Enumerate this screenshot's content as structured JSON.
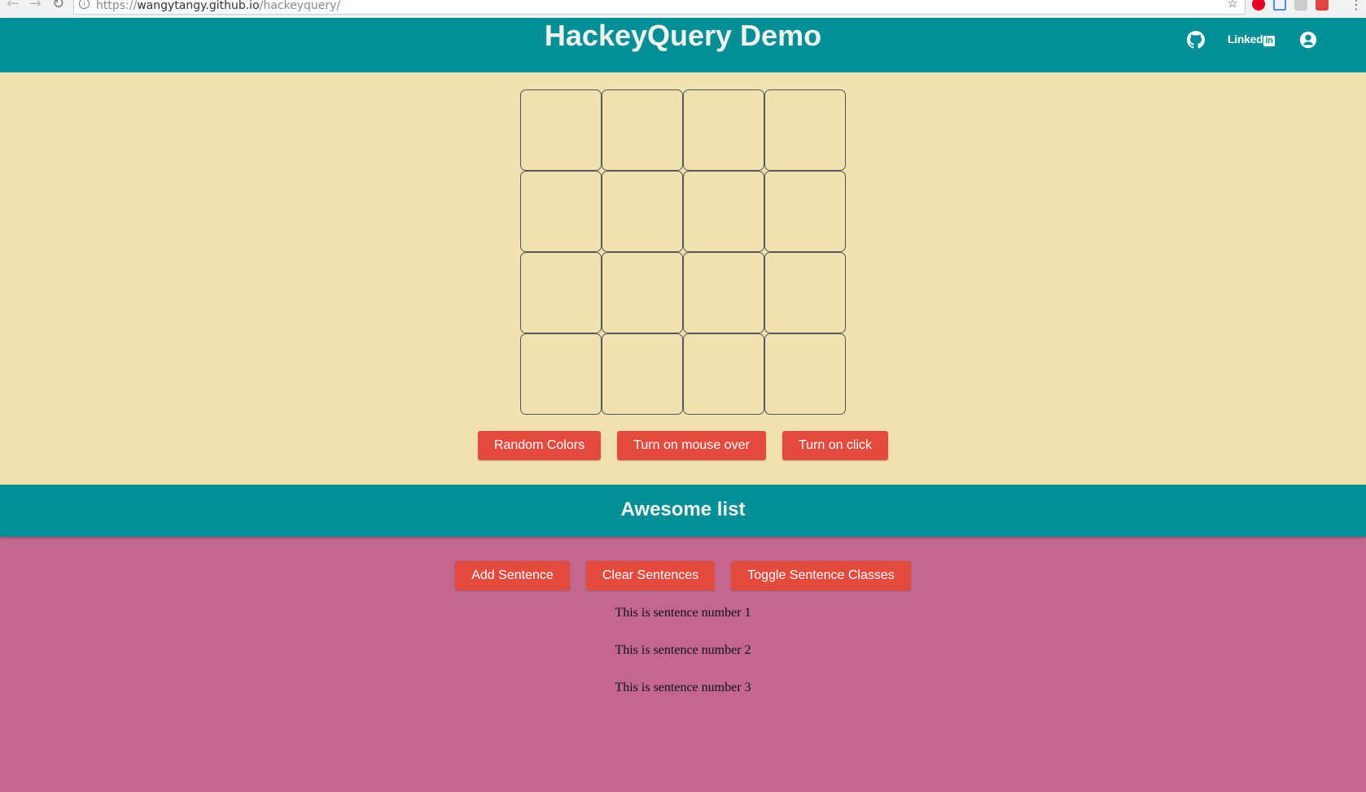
{
  "browser": {
    "url_prefix": "https://",
    "url_host": "wangytangy.github.io",
    "url_path": "/hackeyquery/"
  },
  "header": {
    "title": "HackeyQuery Demo",
    "linkedin_label": "Linked",
    "linkedin_badge": "in",
    "icons": [
      "github-icon",
      "linkedin-icon",
      "user-icon"
    ]
  },
  "grid": {
    "rows": 4,
    "columns": 4
  },
  "grid_buttons": {
    "random_colors": "Random Colors",
    "mouse_over": "Turn on mouse over",
    "click": "Turn on click"
  },
  "list_section": {
    "title": "Awesome list",
    "buttons": {
      "add": "Add Sentence",
      "clear": "Clear Sentences",
      "toggle": "Toggle Sentence Classes"
    },
    "sentences": [
      "This is sentence number 1",
      "This is sentence number 2",
      "This is sentence number 3"
    ]
  },
  "colors": {
    "header": "#008f96",
    "grid_background": "#f0e2b0",
    "list_background": "#c3678f",
    "button": "#e34b3f"
  }
}
